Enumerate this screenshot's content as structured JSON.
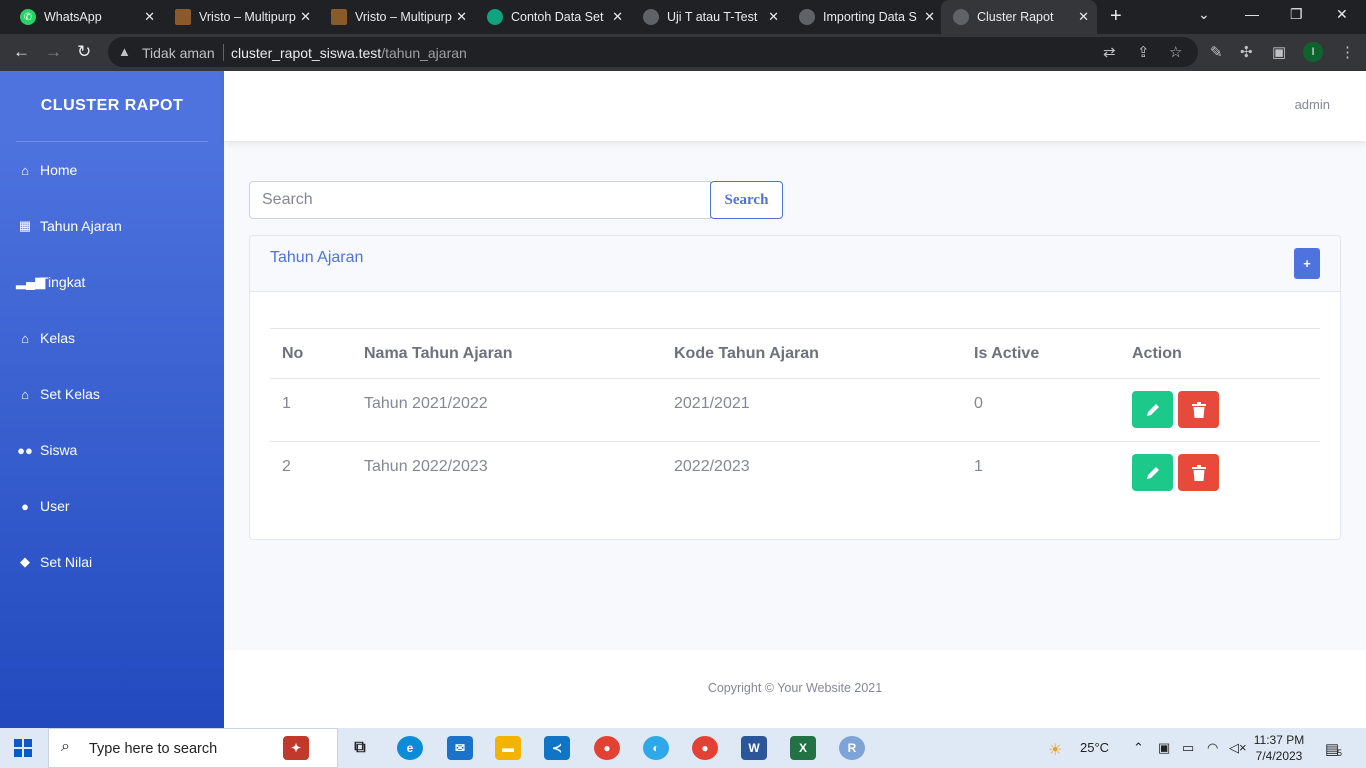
{
  "browser": {
    "tabs": [
      {
        "title": "WhatsApp",
        "icon": "whatsapp-icon",
        "color": "#25d366"
      },
      {
        "title": "Vristo – Multipurp",
        "icon": "vristo-icon",
        "color": "#8a5a2b"
      },
      {
        "title": "Vristo – Multipurp",
        "icon": "vristo-icon",
        "color": "#8a5a2b"
      },
      {
        "title": "Contoh Data Set",
        "icon": "chatgpt-icon",
        "color": "#10a37f"
      },
      {
        "title": "Uji T atau T-Test",
        "icon": "site-icon",
        "color": "#5f6368"
      },
      {
        "title": "Importing Data S",
        "icon": "globe-icon",
        "color": "#5f6368"
      },
      {
        "title": "Cluster Rapot",
        "icon": "globe-icon",
        "color": "#5f6368"
      }
    ],
    "security_label": "Tidak aman",
    "url_host": "cluster_rapot_siswa.test",
    "url_path": "/tahun_ajaran",
    "profile_initial": "I"
  },
  "sidebar": {
    "brand": "CLUSTER RAPOT",
    "items": [
      {
        "label": "Home",
        "icon": "home-icon"
      },
      {
        "label": "Tahun Ajaran",
        "icon": "calendar-icon"
      },
      {
        "label": "Tingkat",
        "icon": "signal-icon"
      },
      {
        "label": "Kelas",
        "icon": "university-icon"
      },
      {
        "label": "Set Kelas",
        "icon": "university-icon"
      },
      {
        "label": "Siswa",
        "icon": "users-icon"
      },
      {
        "label": "User",
        "icon": "user-icon"
      },
      {
        "label": "Set Nilai",
        "icon": "graduation-cap-icon"
      }
    ]
  },
  "topbar": {
    "user": "admin"
  },
  "search": {
    "placeholder": "Search",
    "value": "",
    "button_label": "Search"
  },
  "card": {
    "title": "Tahun Ajaran",
    "add_label": "+",
    "columns": [
      "No",
      "Nama Tahun Ajaran",
      "Kode Tahun Ajaran",
      "Is Active",
      "Action"
    ],
    "rows": [
      {
        "no": "1",
        "nama": "Tahun 2021/2022",
        "kode": "2021/2021",
        "is_active": "0"
      },
      {
        "no": "2",
        "nama": "Tahun 2022/2023",
        "kode": "2022/2023",
        "is_active": "1"
      }
    ]
  },
  "footer": {
    "copyright": "Copyright © Your Website 2021"
  },
  "taskbar": {
    "search_placeholder": "Type here to search",
    "temperature": "25°C",
    "time": "11:37 PM",
    "date": "7/4/2023",
    "notification_count": "5"
  },
  "colors": {
    "primary": "#4e73df",
    "success": "#1cc88a",
    "danger": "#e74a3b"
  }
}
